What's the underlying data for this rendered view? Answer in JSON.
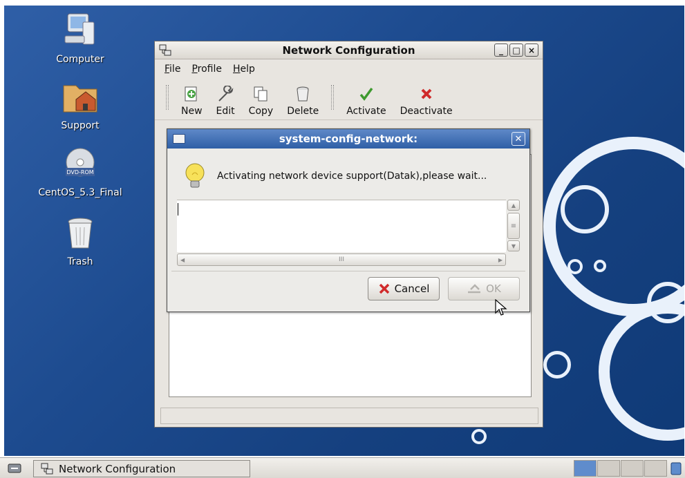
{
  "desktop": {
    "icons": [
      {
        "label": "Computer"
      },
      {
        "label": "Support"
      },
      {
        "label": "CentOS_5.3_Final",
        "badge": "DVD-ROM"
      },
      {
        "label": "Trash"
      }
    ]
  },
  "window": {
    "title": "Network Configuration",
    "menu": [
      "File",
      "Profile",
      "Help"
    ],
    "toolbar": [
      "New",
      "Edit",
      "Copy",
      "Delete",
      "Activate",
      "Deactivate"
    ],
    "buttons": {
      "minimize": "_",
      "maximize": "□",
      "close": "×"
    }
  },
  "dialog": {
    "title": "system-config-network:",
    "message": "Activating network device support(Datak),please wait...",
    "text_content": "",
    "hscroll_glyph": "III",
    "cancel_label": "Cancel",
    "ok_label": "OK"
  },
  "taskbar": {
    "task_label": "Network Configuration",
    "workspaces": 4,
    "active_workspace": 1
  },
  "colors": {
    "desktop_bg": "#1d4b8f",
    "dialog_title_bg": "#2f5fa6",
    "window_bg": "#e8e5e0"
  }
}
